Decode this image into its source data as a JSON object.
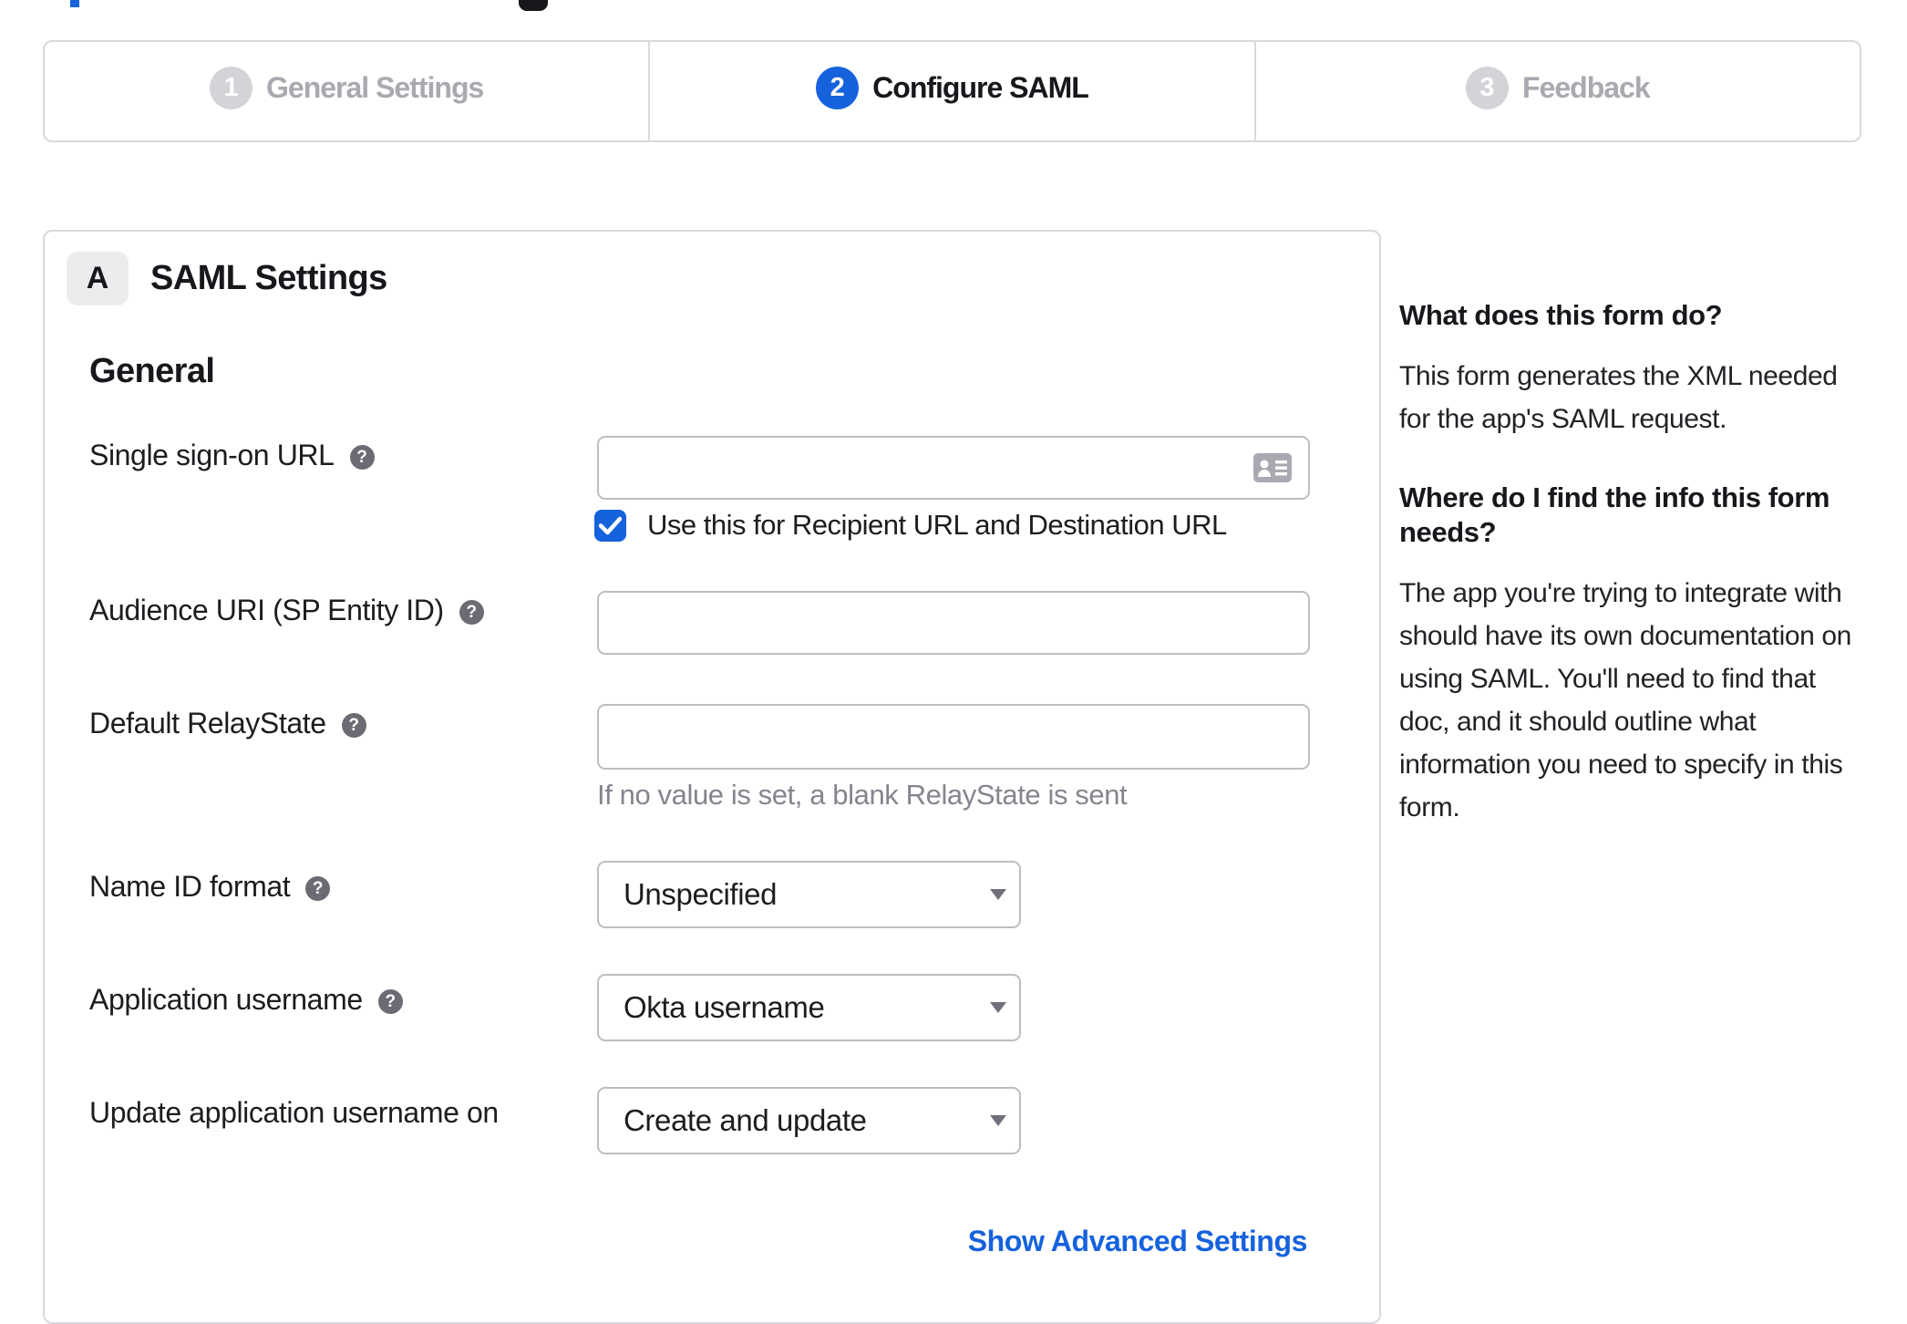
{
  "accent_color": "#1662dd",
  "stepper": {
    "steps": [
      {
        "number": "1",
        "label": "General Settings",
        "state": "inactive"
      },
      {
        "number": "2",
        "label": "Configure SAML",
        "state": "active"
      },
      {
        "number": "3",
        "label": "Feedback",
        "state": "inactive"
      }
    ]
  },
  "form": {
    "section_badge": "A",
    "section_title": "SAML Settings",
    "group_heading": "General",
    "fields": [
      {
        "label": "Single sign-on URL",
        "type": "text",
        "value": "",
        "trailing_icon": "contact-card-icon",
        "checkbox": {
          "checked": true,
          "label": "Use this for Recipient URL and Destination URL"
        }
      },
      {
        "label": "Audience URI (SP Entity ID)",
        "type": "text",
        "value": ""
      },
      {
        "label": "Default RelayState",
        "type": "text",
        "value": "",
        "hint": "If no value is set, a blank RelayState is sent"
      },
      {
        "label": "Name ID format",
        "type": "select",
        "value": "Unspecified"
      },
      {
        "label": "Application username",
        "type": "select",
        "value": "Okta username"
      },
      {
        "label": "Update application username on",
        "type": "select",
        "value": "Create and update"
      }
    ],
    "advanced_link": "Show Advanced Settings"
  },
  "help_panel": {
    "sections": [
      {
        "heading": "What does this form do?",
        "body": "This form generates the XML needed for the app's SAML request."
      },
      {
        "heading": "Where do I find the info this form needs?",
        "body": "The app you're trying to integrate with should have its own documentation on using SAML. You'll need to find that doc, and it should outline what information you need to specify in this form."
      }
    ]
  }
}
